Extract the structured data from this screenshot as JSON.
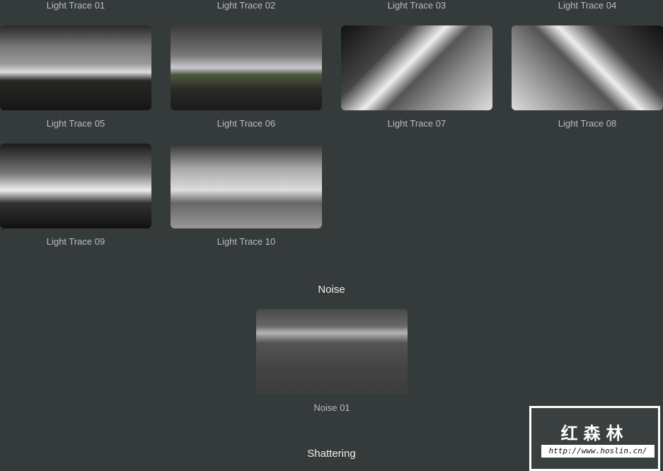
{
  "top_labels": [
    "Light Trace 01",
    "Light Trace 02",
    "Light Trace 03",
    "Light Trace 04"
  ],
  "light_trace_items": [
    {
      "label": "Light Trace 05"
    },
    {
      "label": "Light Trace 06"
    },
    {
      "label": "Light Trace 07"
    },
    {
      "label": "Light Trace 08"
    },
    {
      "label": "Light Trace 09"
    },
    {
      "label": "Light Trace 10"
    }
  ],
  "sections": {
    "noise": "Noise",
    "shattering": "Shattering"
  },
  "noise_items": [
    {
      "label": "Noise 01"
    }
  ],
  "watermark": {
    "title": "红森林",
    "url": "http://www.hoslin.cn/"
  }
}
